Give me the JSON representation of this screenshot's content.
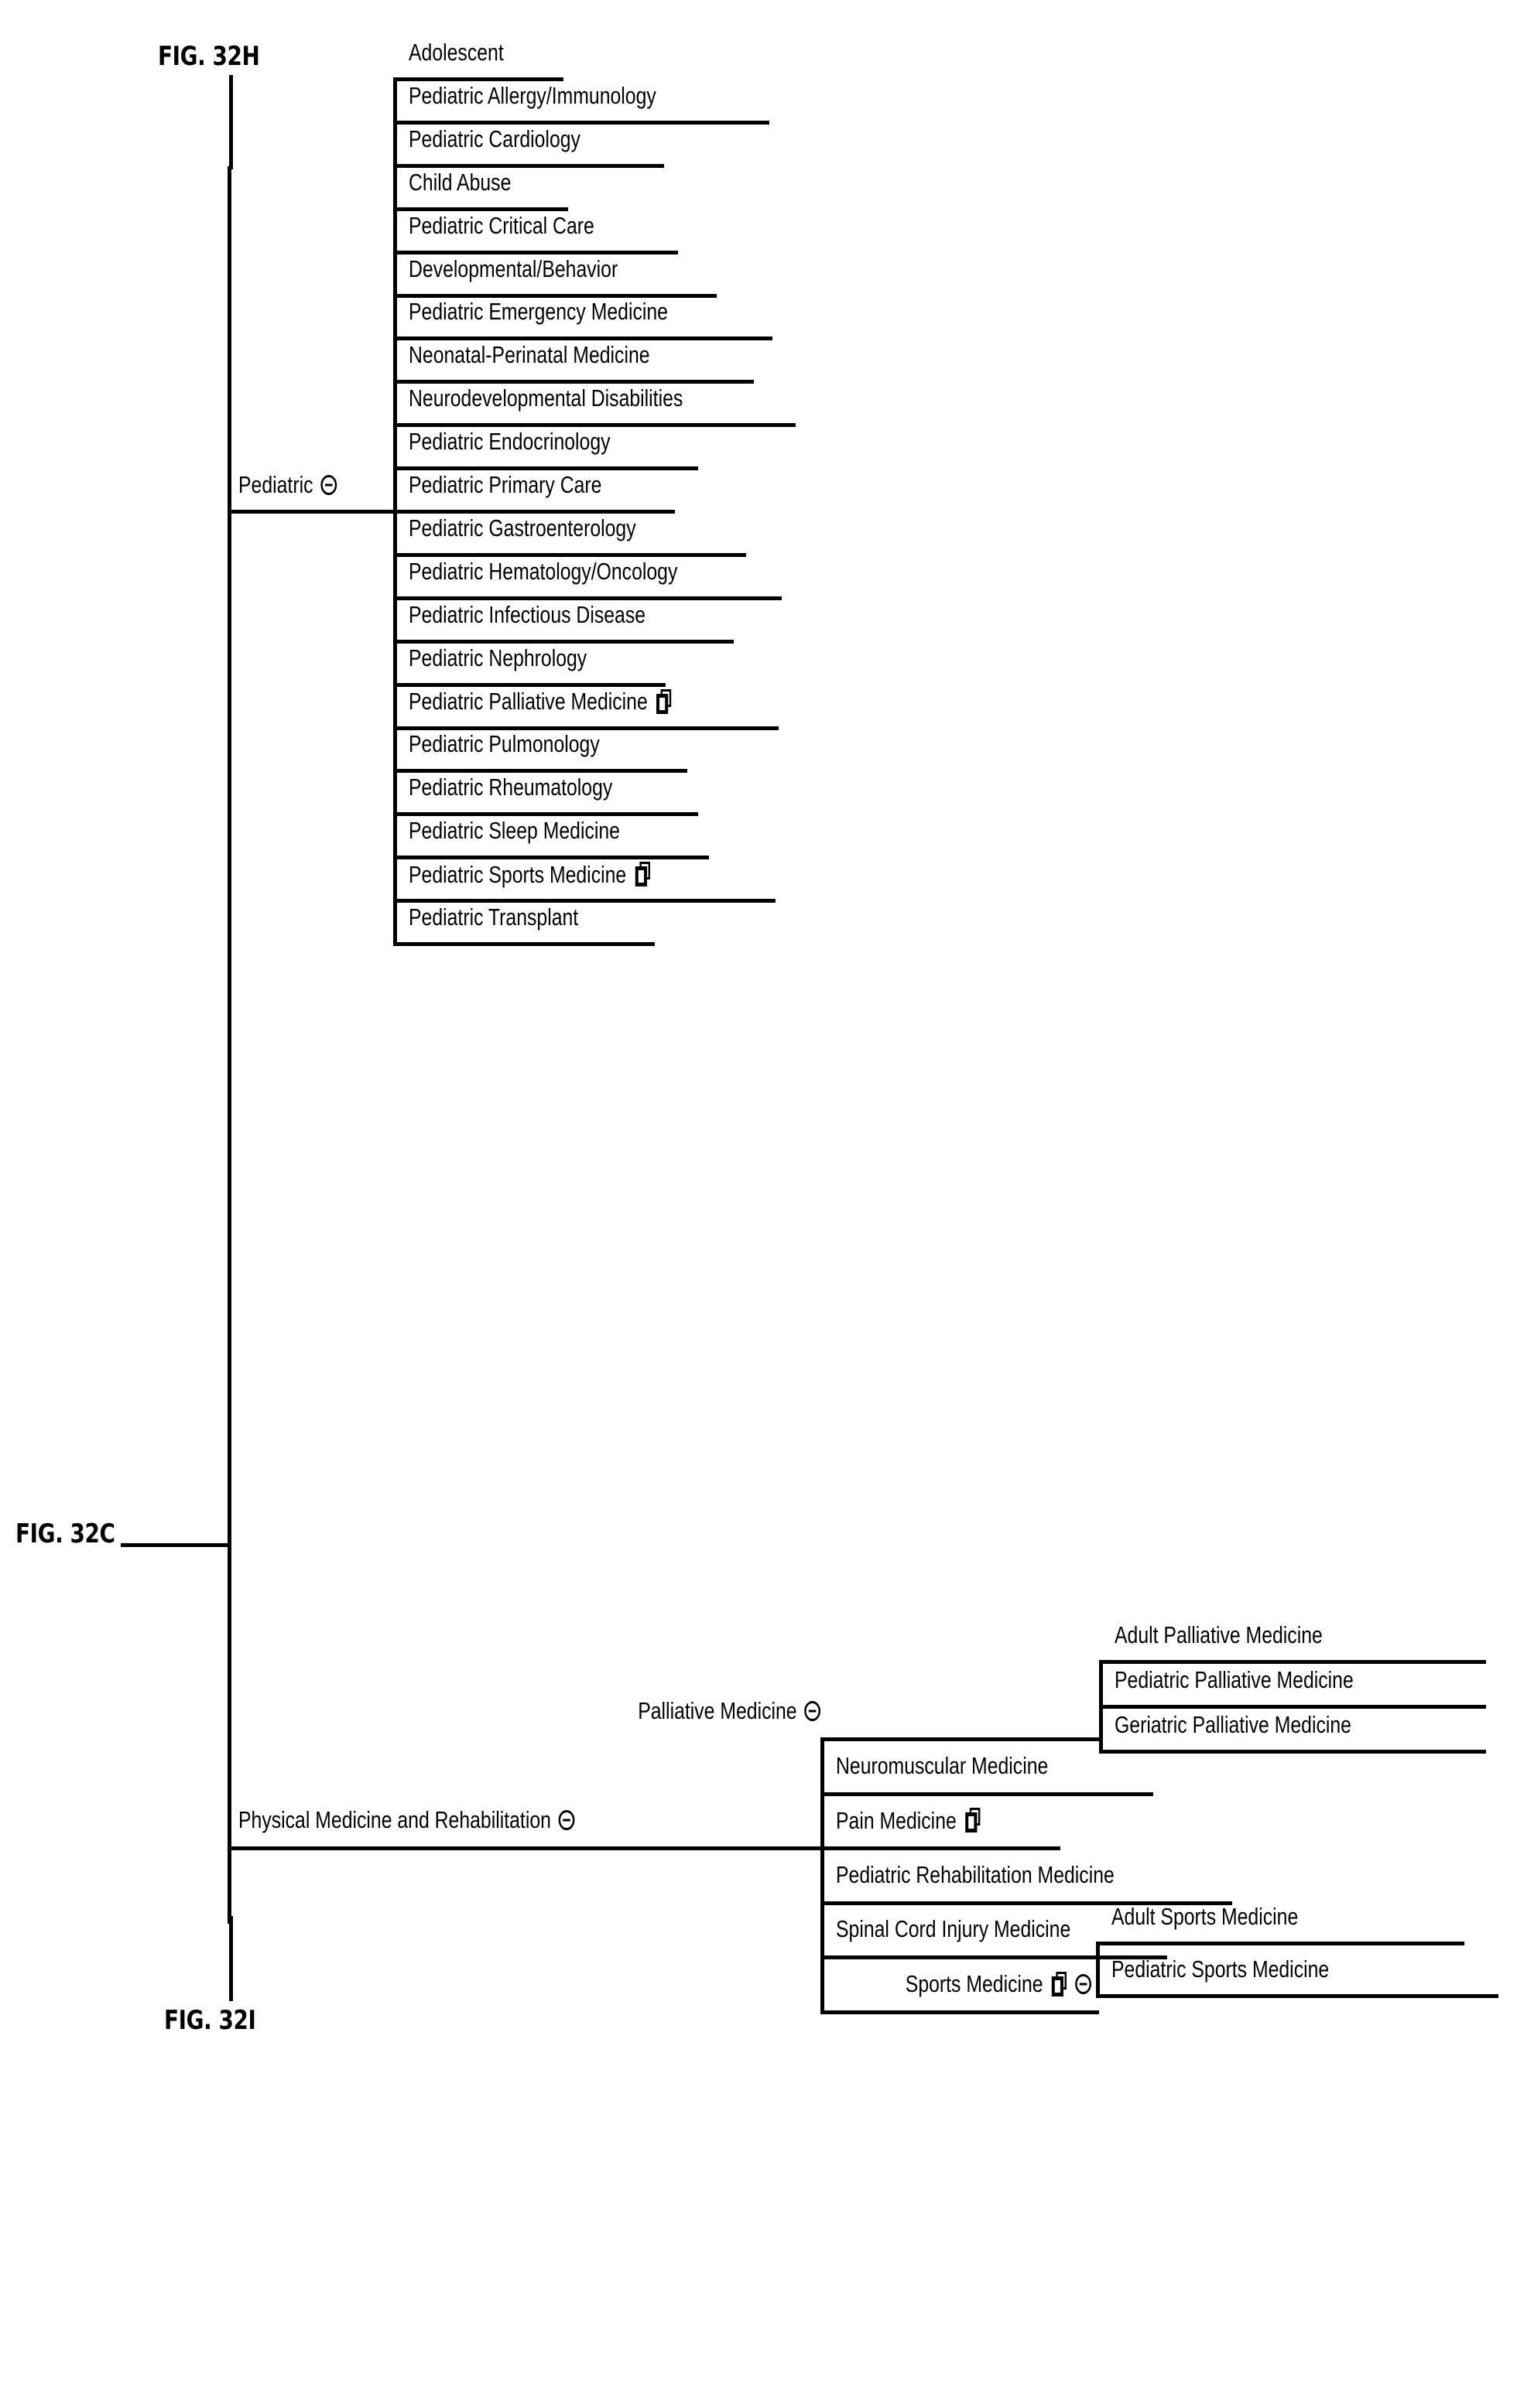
{
  "figure": {
    "main_label": "FIG. 32C",
    "top_continuation_label": "FIG. 32H",
    "bottom_continuation_label": "FIG. 32I"
  },
  "icons": {
    "collapse": "circled-minus-icon",
    "copy": "duplicate-sheets-icon"
  },
  "tree": {
    "branches": [
      {
        "id": "pediatric",
        "label": "Pediatric",
        "has_collapse_icon": true,
        "has_copy_icon": false,
        "children": [
          {
            "label": "Adolescent",
            "has_copy_icon": false
          },
          {
            "label": "Pediatric Allergy/Immunology",
            "has_copy_icon": false
          },
          {
            "label": "Pediatric Cardiology",
            "has_copy_icon": false
          },
          {
            "label": "Child Abuse",
            "has_copy_icon": false
          },
          {
            "label": "Pediatric Critical Care",
            "has_copy_icon": false
          },
          {
            "label": "Developmental/Behavior",
            "has_copy_icon": false
          },
          {
            "label": "Pediatric Emergency Medicine",
            "has_copy_icon": false
          },
          {
            "label": "Neonatal-Perinatal Medicine",
            "has_copy_icon": false
          },
          {
            "label": "Neurodevelopmental Disabilities",
            "has_copy_icon": false
          },
          {
            "label": "Pediatric Endocrinology",
            "has_copy_icon": false
          },
          {
            "label": "Pediatric Primary Care",
            "has_copy_icon": false
          },
          {
            "label": "Pediatric Gastroenterology",
            "has_copy_icon": false
          },
          {
            "label": "Pediatric Hematology/Oncology",
            "has_copy_icon": false
          },
          {
            "label": "Pediatric Infectious Disease",
            "has_copy_icon": false
          },
          {
            "label": "Pediatric Nephrology",
            "has_copy_icon": false
          },
          {
            "label": "Pediatric Palliative Medicine",
            "has_copy_icon": true
          },
          {
            "label": "Pediatric Pulmonology",
            "has_copy_icon": false
          },
          {
            "label": "Pediatric Rheumatology",
            "has_copy_icon": false
          },
          {
            "label": "Pediatric Sleep Medicine",
            "has_copy_icon": false
          },
          {
            "label": "Pediatric Sports Medicine",
            "has_copy_icon": true
          },
          {
            "label": "Pediatric Transplant",
            "has_copy_icon": false
          }
        ]
      },
      {
        "id": "pmr",
        "label": "Physical Medicine and Rehabilitation",
        "has_collapse_icon": true,
        "has_copy_icon": false,
        "children": [
          {
            "label": "Palliative Medicine",
            "has_copy_icon": false,
            "has_collapse_icon": true,
            "children": [
              {
                "label": "Adult Palliative Medicine"
              },
              {
                "label": "Pediatric Palliative Medicine"
              },
              {
                "label": "Geriatric Palliative Medicine"
              }
            ]
          },
          {
            "label": "Neuromuscular Medicine",
            "has_copy_icon": false
          },
          {
            "label": "Pain Medicine",
            "has_copy_icon": true
          },
          {
            "label": "Pediatric Rehabilitation Medicine",
            "has_copy_icon": false
          },
          {
            "label": "Spinal Cord Injury Medicine",
            "has_copy_icon": false
          },
          {
            "label": "Sports Medicine",
            "has_copy_icon": true,
            "has_collapse_icon": true,
            "children": [
              {
                "label": "Adult Sports Medicine"
              },
              {
                "label": "Pediatric Sports Medicine"
              }
            ]
          }
        ]
      }
    ]
  },
  "nodes": {
    "adolescent": "Adolescent",
    "ped_allergy": "Pediatric Allergy/Immunology",
    "ped_cardiology": "Pediatric Cardiology",
    "child_abuse": "Child Abuse",
    "ped_critical_care": "Pediatric Critical Care",
    "developmental_behavior": "Developmental/Behavior",
    "ped_emergency": "Pediatric Emergency Medicine",
    "neonatal_perinatal": "Neonatal-Perinatal Medicine",
    "neurodev_disabilities": "Neurodevelopmental Disabilities",
    "ped_endocrinology": "Pediatric Endocrinology",
    "ped_primary_care": "Pediatric Primary Care",
    "ped_gastroenterology": "Pediatric Gastroenterology",
    "ped_hematology_oncology": "Pediatric Hematology/Oncology",
    "ped_infectious_disease": "Pediatric Infectious Disease",
    "ped_nephrology": "Pediatric Nephrology",
    "ped_palliative_medicine": "Pediatric Palliative Medicine",
    "ped_pulmonology": "Pediatric Pulmonology",
    "ped_rheumatology": "Pediatric Rheumatology",
    "ped_sleep_medicine": "Pediatric Sleep Medicine",
    "ped_sports_medicine": "Pediatric Sports Medicine",
    "ped_transplant": "Pediatric Transplant",
    "pediatric": "Pediatric",
    "pmr": "Physical Medicine and Rehabilitation",
    "palliative_medicine": "Palliative Medicine",
    "adult_palliative": "Adult Palliative Medicine",
    "ped_palliative_child": "Pediatric Palliative Medicine",
    "geriatric_palliative": "Geriatric Palliative Medicine",
    "neuromuscular_medicine": "Neuromuscular Medicine",
    "pain_medicine": "Pain Medicine",
    "ped_rehab_medicine": "Pediatric Rehabilitation Medicine",
    "spinal_cord_injury": "Spinal Cord Injury Medicine",
    "sports_medicine": "Sports Medicine",
    "adult_sports_medicine": "Adult Sports Medicine",
    "ped_sports_medicine_child": "Pediatric Sports Medicine"
  },
  "colors": {
    "ink": "#000000",
    "paper": "#ffffff"
  }
}
